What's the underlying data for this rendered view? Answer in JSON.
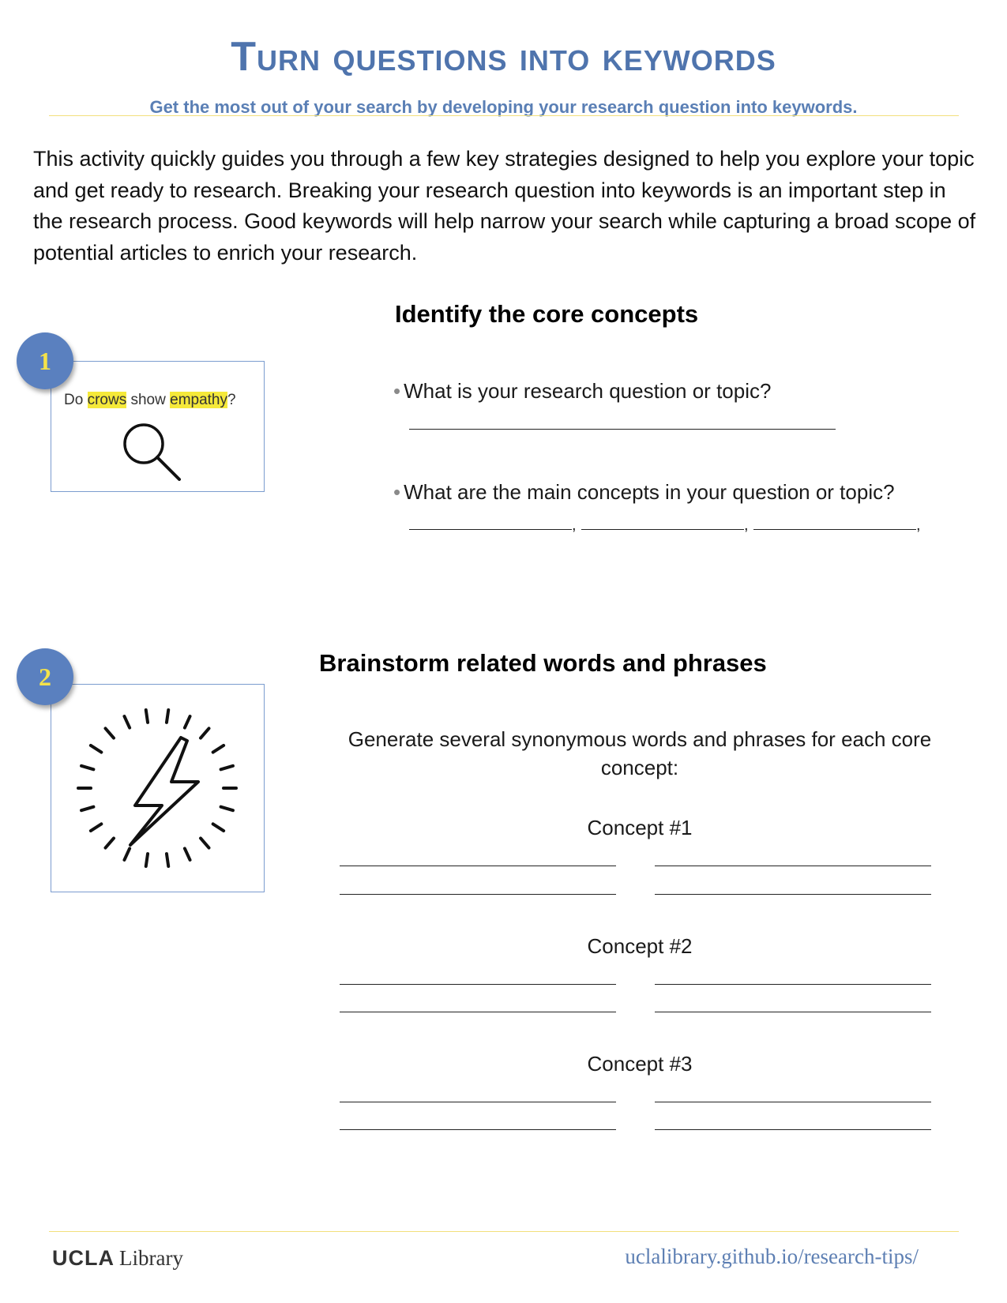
{
  "title": "Turn questions into keywords",
  "subtitle": "Get the most out of your search by developing your research question into keywords.",
  "intro": "This activity quickly guides you through a few key strategies designed to help you explore your topic and get ready to research. Breaking your research question into keywords is an important step in the research process. Good keywords will help narrow your search while capturing a broad scope of potential articles to enrich your research.",
  "step1": {
    "number": "1",
    "heading": "Identify the core concepts",
    "illustration": {
      "prefix": "Do",
      "highlight1": "crows",
      "middle": "show",
      "highlight2": "empathy",
      "suffix": "?",
      "icon": "magnifier-icon",
      "highlight_color": "#f5e93a"
    },
    "question1": "What is your research question or topic?",
    "question2": "What are the main concepts in your question or topic?",
    "separator": ","
  },
  "step2": {
    "number": "2",
    "heading": "Brainstorm related words and phrases",
    "icon": "lightning-burst-icon",
    "instruction": "Generate several synonymous words and phrases for each core concept:",
    "concepts": [
      "Concept #1",
      "Concept #2",
      "Concept #3"
    ]
  },
  "footer": {
    "logo_bold": "UCLA",
    "logo_light": "Library",
    "link": "uclalibrary.github.io/research-tips/"
  },
  "colors": {
    "title": "#4f74ad",
    "badge": "#5a80bf",
    "badge_number": "#f4e24a",
    "rule": "#f2e07c",
    "link": "#5d7fb3"
  }
}
